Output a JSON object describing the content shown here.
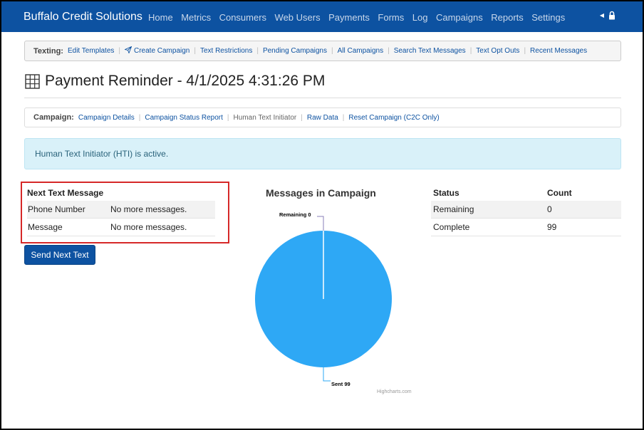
{
  "navbar": {
    "brand": "Buffalo Credit Solutions",
    "items": [
      "Home",
      "Metrics",
      "Consumers",
      "Web Users",
      "Payments",
      "Forms",
      "Log",
      "Campaigns",
      "Reports",
      "Settings"
    ],
    "bg_color": "#0d52a1"
  },
  "texting_bar": {
    "label": "Texting:",
    "links": [
      "Edit Templates",
      "Create Campaign",
      "Text Restrictions",
      "Pending Campaigns",
      "All Campaigns",
      "Search Text Messages",
      "Text Opt Outs",
      "Recent Messages"
    ]
  },
  "page": {
    "title": "Payment Reminder - 4/1/2025 4:31:26 PM"
  },
  "campaign_bar": {
    "label": "Campaign:",
    "links": [
      "Campaign Details",
      "Campaign Status Report",
      "Human Text Initiator",
      "Raw Data",
      "Reset Campaign (C2C Only)"
    ]
  },
  "alert": {
    "text": "Human Text Initiator (HTI) is active."
  },
  "next_text": {
    "heading": "Next Text Message",
    "rows": [
      {
        "label": "Phone Number",
        "value": "No more messages."
      },
      {
        "label": "Message",
        "value": "No more messages."
      }
    ]
  },
  "send_button": "Send Next Text",
  "chart_data": {
    "type": "pie",
    "title": "Messages in Campaign",
    "slices": [
      {
        "name": "Remaining",
        "value": 0,
        "label": "Remaining 0"
      },
      {
        "name": "Sent",
        "value": 99,
        "label": "Sent 99"
      }
    ],
    "colors": [
      "#2ea8f5"
    ],
    "credits": "Highcharts.com"
  },
  "status_table": {
    "headers": [
      "Status",
      "Count"
    ],
    "rows": [
      {
        "status": "Remaining",
        "count": "0"
      },
      {
        "status": "Complete",
        "count": "99"
      }
    ]
  }
}
